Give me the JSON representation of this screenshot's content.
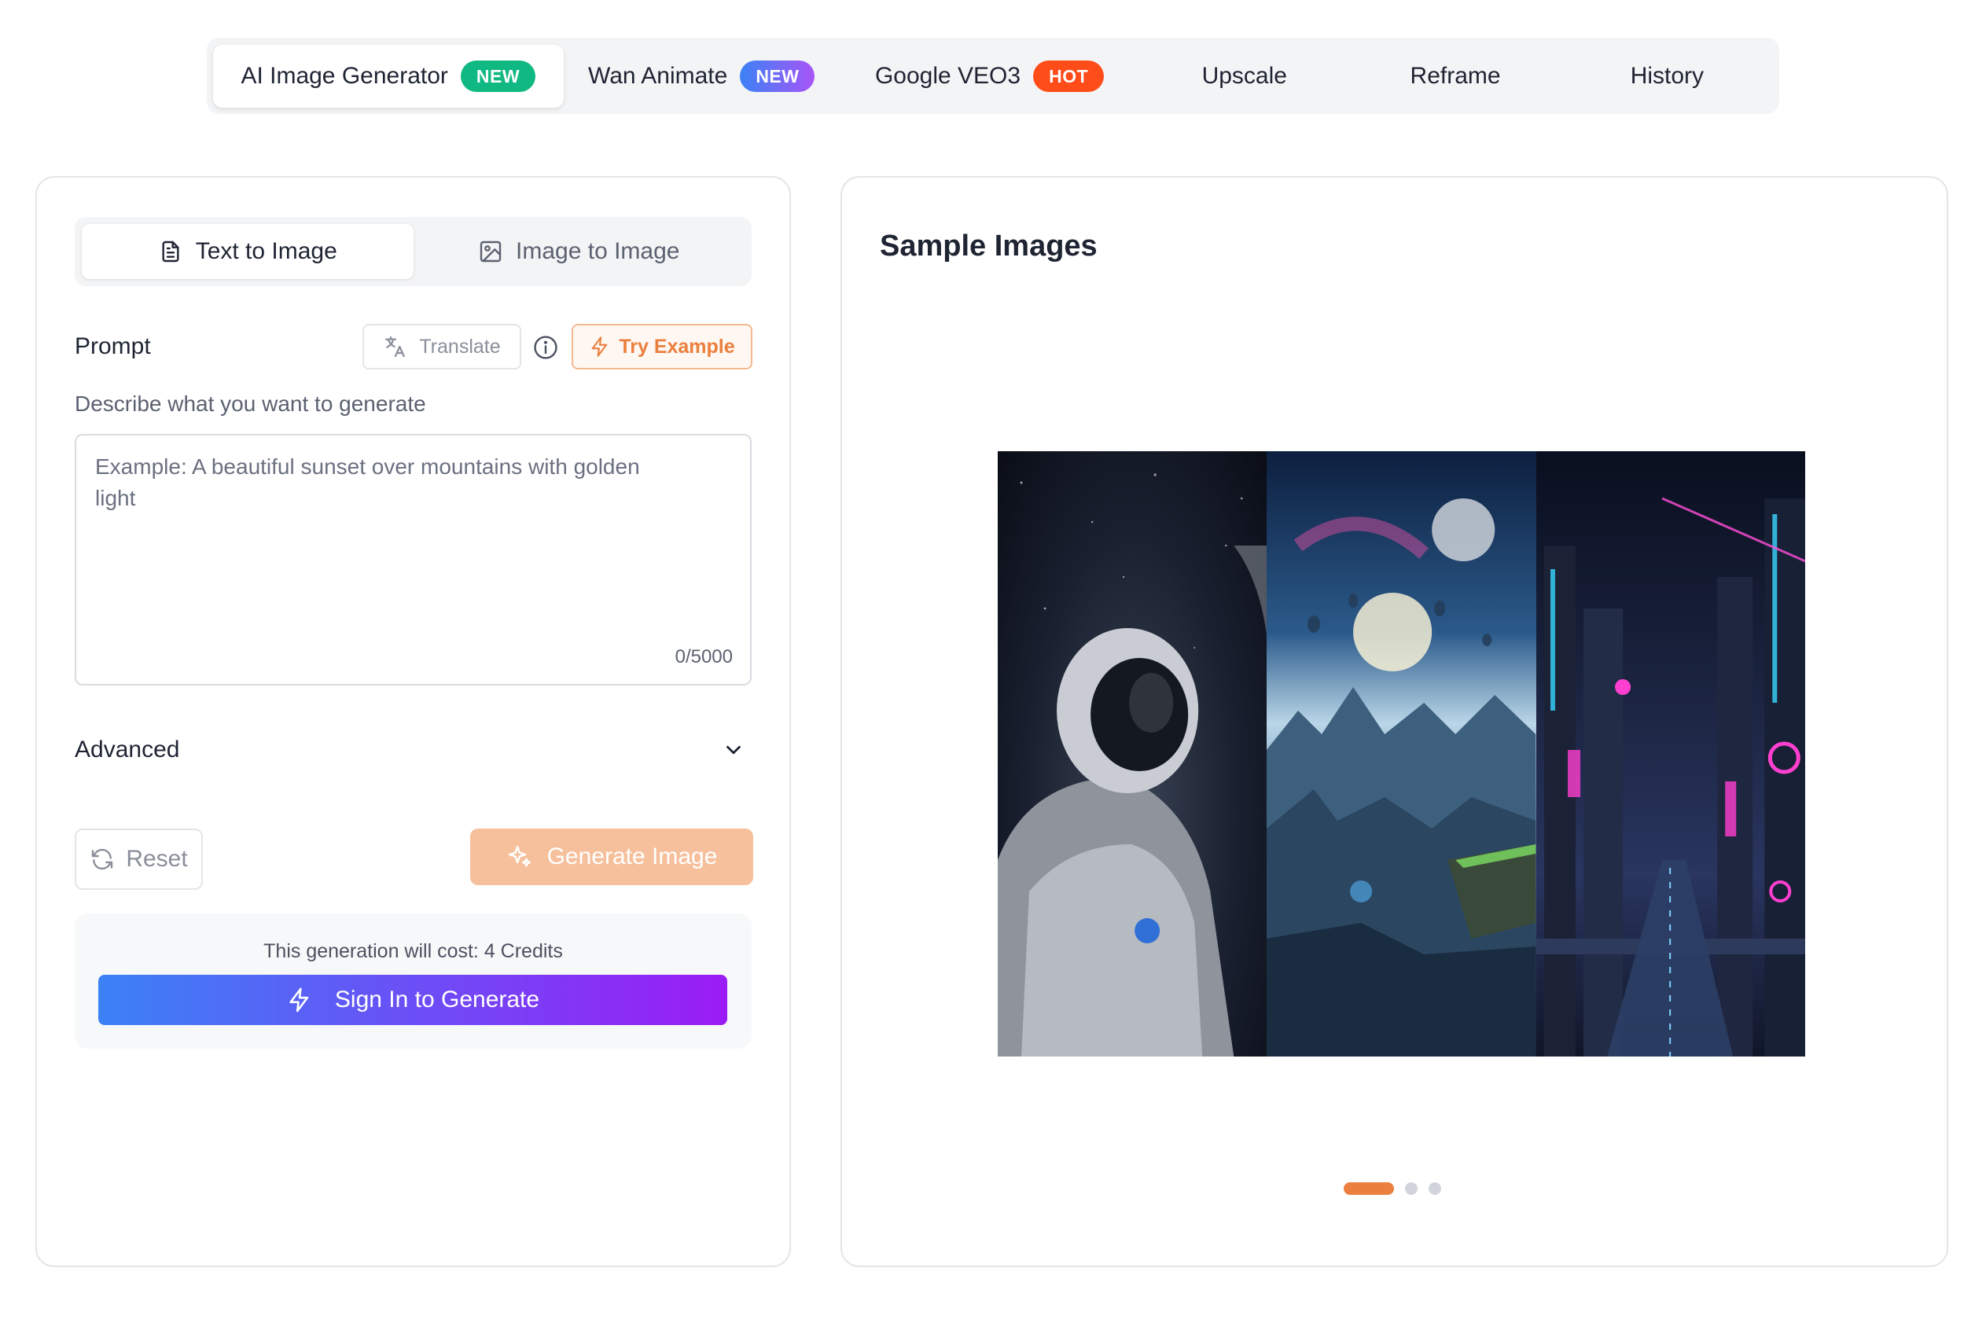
{
  "nav": {
    "tabs": [
      {
        "label": "AI Image Generator",
        "badge": "NEW"
      },
      {
        "label": "Wan Animate",
        "badge": "NEW"
      },
      {
        "label": "Google VEO3",
        "badge": "HOT"
      },
      {
        "label": "Upscale"
      },
      {
        "label": "Reframe"
      },
      {
        "label": "History"
      }
    ]
  },
  "form": {
    "modes": [
      "Text to Image",
      "Image to Image"
    ],
    "prompt_label": "Prompt",
    "translate_label": "Translate",
    "try_example_label": "Try Example",
    "describe_label": "Describe what you want to generate",
    "prompt_placeholder": "Example: A beautiful sunset over mountains with golden light",
    "prompt_value": "",
    "char_count": "0/5000",
    "advanced_label": "Advanced",
    "reset_label": "Reset",
    "generate_label": "Generate Image",
    "cost_text": "This generation will cost: 4 Credits",
    "signin_label": "Sign In to Generate"
  },
  "samples": {
    "title": "Sample Images",
    "slide_count": 3,
    "active_slide": 0
  },
  "colors": {
    "accent": "#ea7f3e",
    "badge_new": "#10b981",
    "badge_hot": "#ff4d1a",
    "gradient_start": "#3b82f6",
    "gradient_end": "#9b1cf5"
  }
}
